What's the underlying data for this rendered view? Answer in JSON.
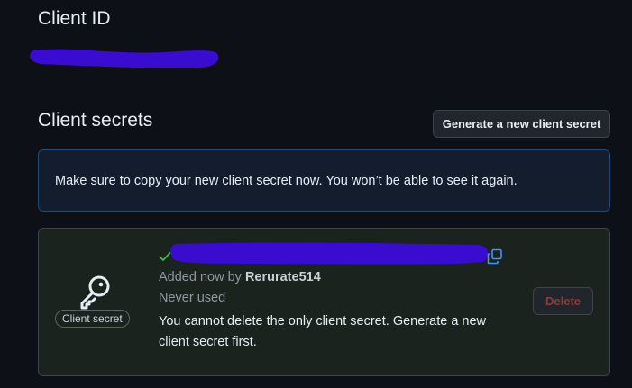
{
  "client_id": {
    "heading": "Client ID"
  },
  "client_secrets": {
    "heading": "Client secrets",
    "generate_button_label": "Generate a new client secret",
    "flash_message": "Make sure to copy your new client secret now. You won’t be able to see it again.",
    "secret": {
      "type_label": "Client secret",
      "added_prefix": "Added now by ",
      "added_by": "Rerurate514",
      "usage_status": "Never used",
      "warning": "You cannot delete the only client secret. Generate a new client secret first.",
      "delete_button_label": "Delete",
      "icons": {
        "key": "key-icon",
        "check": "check-icon",
        "copy": "copy-icon"
      }
    }
  },
  "colors": {
    "background": "#0d1117",
    "redaction": "#3a0ccf",
    "success": "#3fb950",
    "accent": "#4493f8",
    "danger_muted": "#8e3a3a"
  }
}
